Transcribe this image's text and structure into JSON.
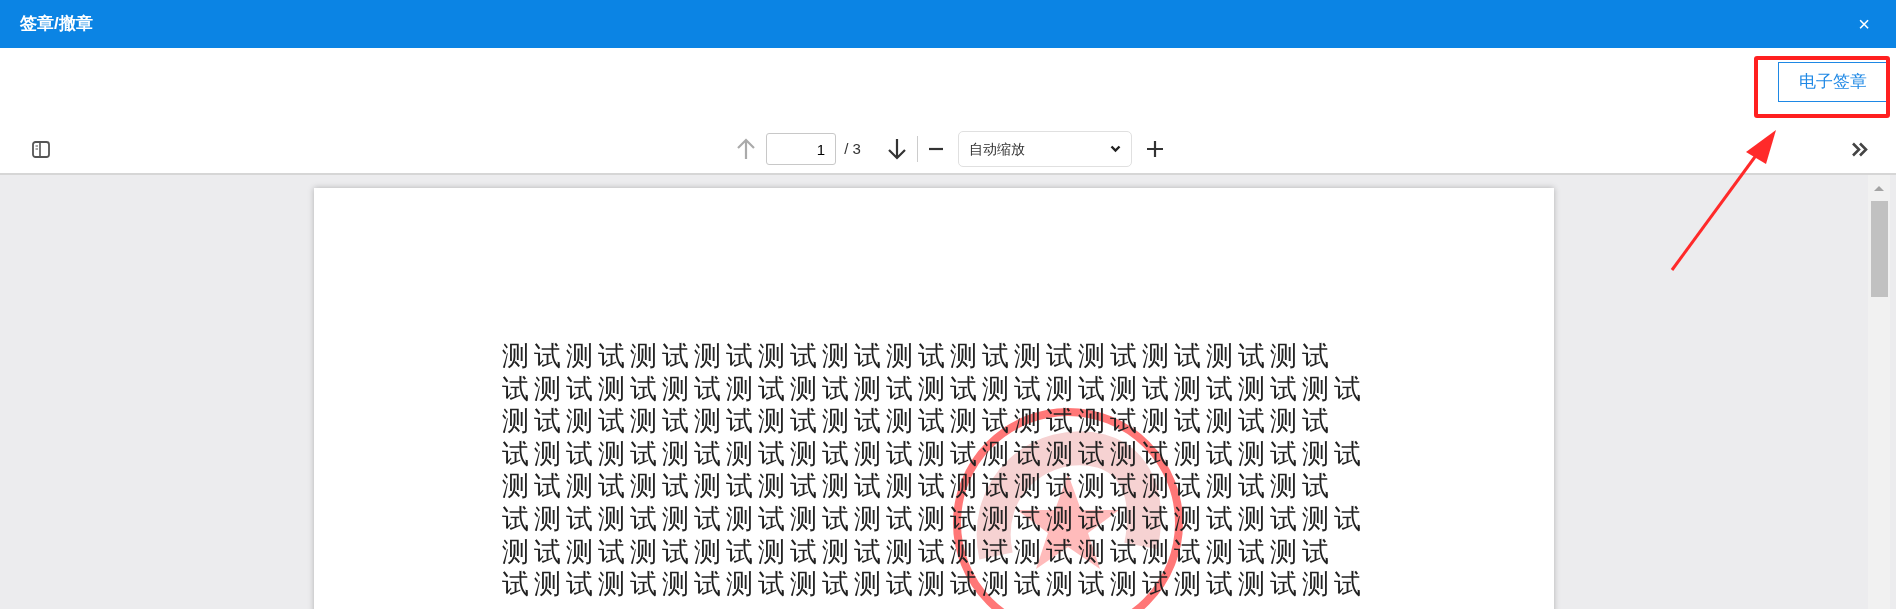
{
  "dialog": {
    "title": "签章/撤章",
    "close": "×"
  },
  "actions": [
    {
      "label": "电子签章"
    }
  ],
  "toolbar": {
    "previous": {
      "disabled": true
    },
    "page_number": "1",
    "page_count": "/ 3",
    "next": {
      "disabled": false
    },
    "zoom": "自动缩放"
  },
  "document": {
    "lines": [
      "测试测试测试测试测试测试测试测试测试测试测试测试测试",
      "试测试测试测试测试测试测试测试测试测试测试测试测试测试",
      "测试测试测试测试测试测试测试测试测试测试测试测试测试",
      "试测试测试测试测试测试测试测试测试测试测试测试测试测试",
      "测试测试测试测试测试测试测试测试测试测试测试测试测试",
      "试测试测试测试测试测试测试测试测试测试测试测试测试测试",
      "测试测试测试测试测试测试测试测试测试测试测试测试测试",
      "试测试测试测试测试测试测试测试测试测试测试测试测试测试"
    ]
  }
}
